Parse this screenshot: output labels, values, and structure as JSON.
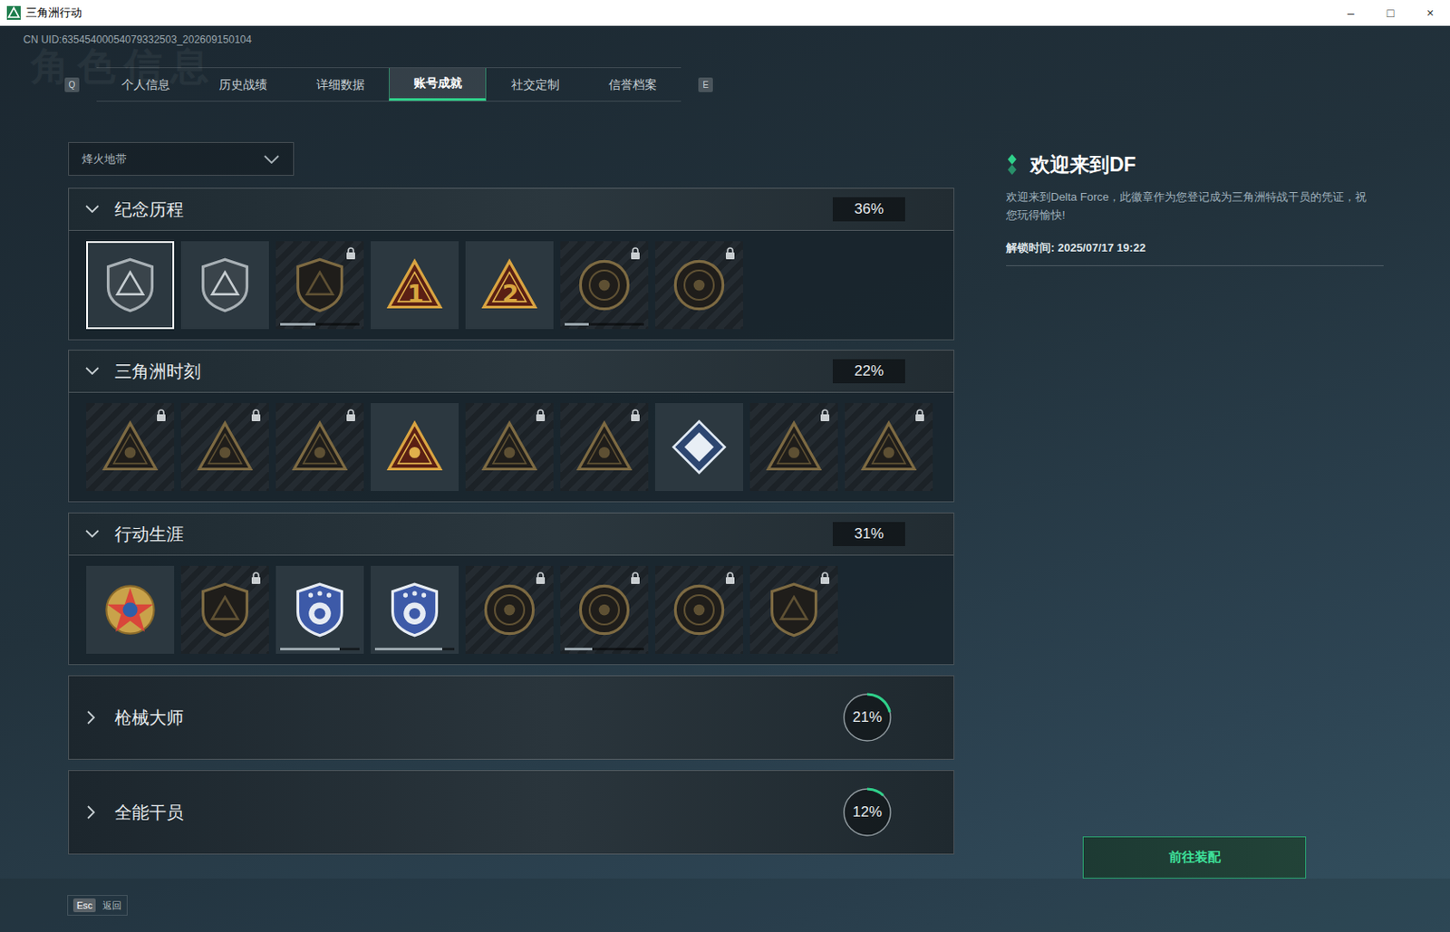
{
  "window": {
    "title": "三角洲行动",
    "controls": [
      "–",
      "□",
      "×"
    ]
  },
  "uid": "CN UID:63545400054079332503_202609150104",
  "watermark": "角色信息",
  "tab_keys": [
    "Q",
    "E"
  ],
  "tabs": [
    {
      "label": "个人信息",
      "selected": false
    },
    {
      "label": "历史战绩",
      "selected": false
    },
    {
      "label": "详细数据",
      "selected": false
    },
    {
      "label": "账号成就",
      "selected": true
    },
    {
      "label": "社交定制",
      "selected": false
    },
    {
      "label": "信誉档案",
      "selected": false
    }
  ],
  "mode_select": {
    "value": "烽火地带"
  },
  "sections": [
    {
      "title": "纪念历程",
      "percent": "36%",
      "expanded": true,
      "badges": [
        {
          "kind": "shield",
          "locked": false,
          "selected": true
        },
        {
          "kind": "shield",
          "locked": false,
          "selected": false
        },
        {
          "kind": "shield",
          "locked": true,
          "selected": false,
          "level": 0.45
        },
        {
          "kind": "triangle",
          "locked": false,
          "selected": false,
          "label": "1"
        },
        {
          "kind": "triangle",
          "locked": false,
          "selected": false,
          "label": "2"
        },
        {
          "kind": "round",
          "locked": true,
          "selected": false,
          "level": 0.3
        },
        {
          "kind": "round",
          "locked": true,
          "selected": false
        }
      ]
    },
    {
      "title": "三角洲时刻",
      "percent": "22%",
      "expanded": true,
      "badges": [
        {
          "kind": "triangle",
          "locked": true,
          "selected": false
        },
        {
          "kind": "triangle",
          "locked": true,
          "selected": false
        },
        {
          "kind": "triangle",
          "locked": true,
          "selected": false
        },
        {
          "kind": "triangle",
          "locked": false,
          "selected": false
        },
        {
          "kind": "triangle",
          "locked": true,
          "selected": false
        },
        {
          "kind": "triangle",
          "locked": true,
          "selected": false
        },
        {
          "kind": "diamond",
          "locked": false,
          "selected": false
        },
        {
          "kind": "triangle",
          "locked": true,
          "selected": false
        },
        {
          "kind": "triangle",
          "locked": true,
          "selected": false
        }
      ]
    },
    {
      "title": "行动生涯",
      "percent": "31%",
      "expanded": true,
      "badges": [
        {
          "kind": "star",
          "locked": false,
          "selected": false
        },
        {
          "kind": "shield",
          "locked": true,
          "selected": false
        },
        {
          "kind": "police",
          "locked": false,
          "selected": false,
          "level": 0.75
        },
        {
          "kind": "police",
          "locked": false,
          "selected": false,
          "level": 0.85
        },
        {
          "kind": "round",
          "locked": true,
          "selected": false
        },
        {
          "kind": "round",
          "locked": true,
          "selected": false,
          "level": 0.35
        },
        {
          "kind": "round",
          "locked": true,
          "selected": false
        },
        {
          "kind": "shield",
          "locked": true,
          "selected": false
        }
      ]
    },
    {
      "title": "枪械大师",
      "percent": "21%",
      "expanded": false,
      "level": 0.21,
      "badges": []
    },
    {
      "title": "全能干员",
      "percent": "12%",
      "expanded": false,
      "level": 0.12,
      "badges": []
    }
  ],
  "detail": {
    "title": "欢迎来到DF",
    "description": "欢迎来到Delta Force，此徽章作为您登记成为三角洲特战干员的凭证，祝您玩得愉快!",
    "unlock_time": "解锁时间: 2025/07/17 19:22"
  },
  "equip_button": "前往装配",
  "footer": {
    "key": "Esc",
    "label": "返回"
  }
}
